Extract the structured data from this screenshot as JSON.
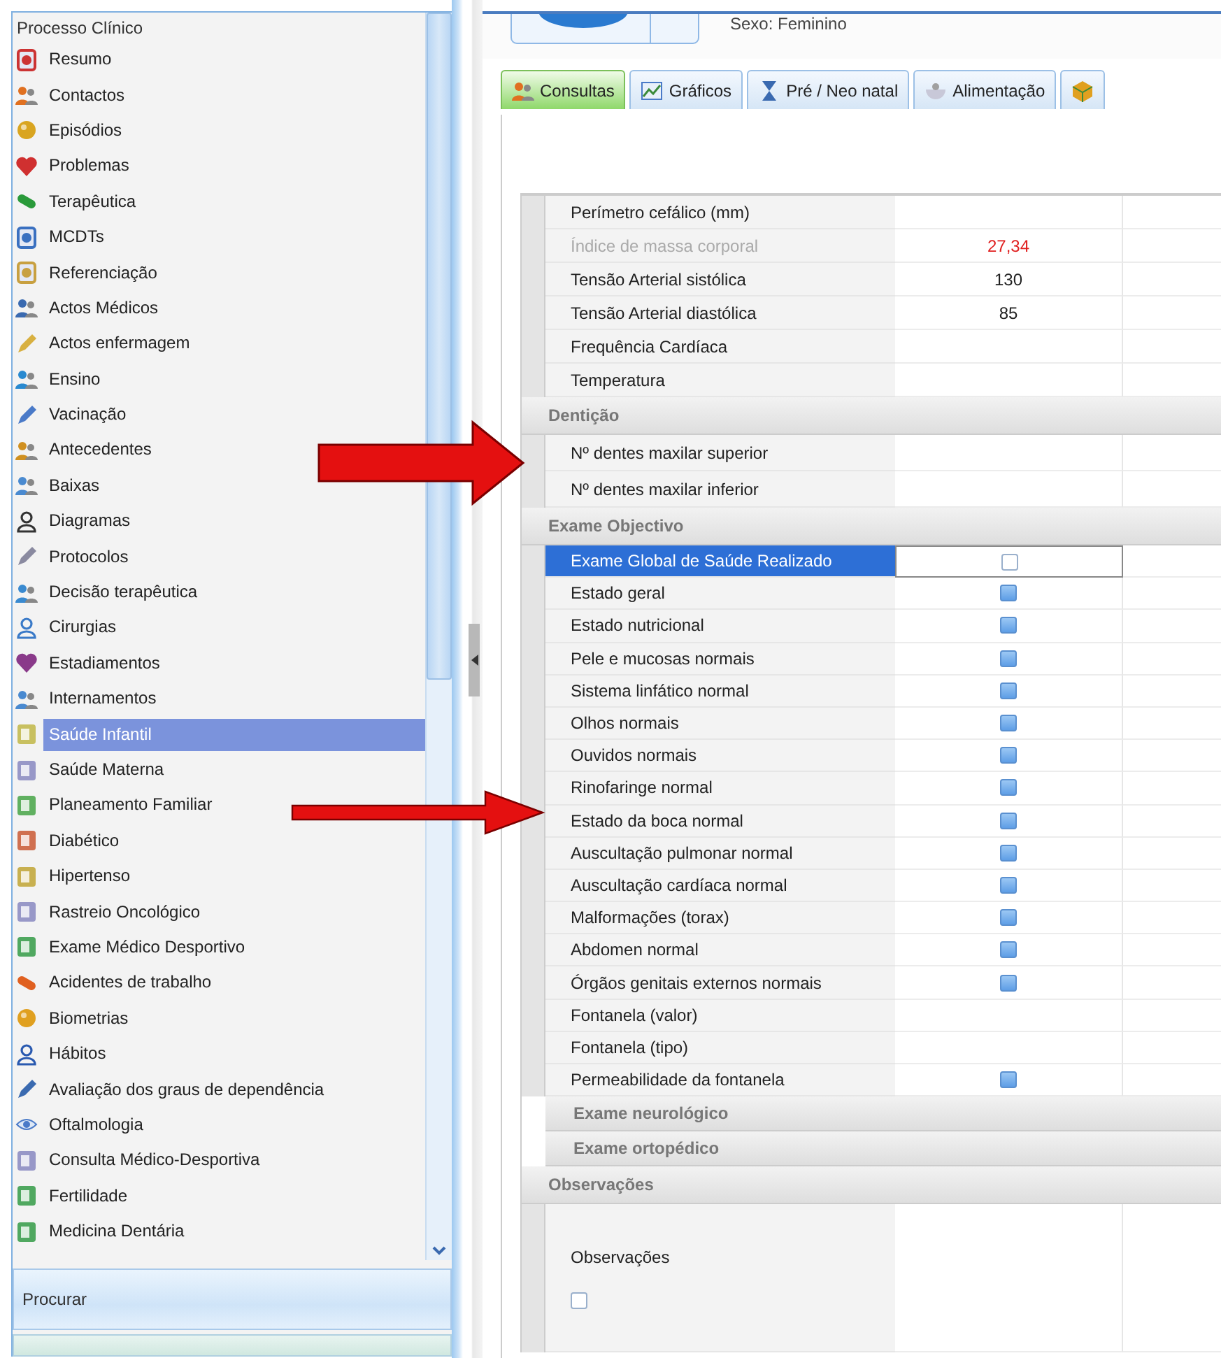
{
  "sidebar": {
    "title": "Processo Clínico",
    "items": [
      {
        "label": "Resumo",
        "kind": "doc",
        "color": "#cc3333",
        "selected": false
      },
      {
        "label": "Contactos",
        "kind": "people",
        "color": "#e07020",
        "selected": false
      },
      {
        "label": "Episódios",
        "kind": "ball",
        "color": "#d9a520",
        "selected": false
      },
      {
        "label": "Problemas",
        "kind": "heart",
        "color": "#d03030",
        "selected": false
      },
      {
        "label": "Terapêutica",
        "kind": "pill",
        "color": "#2a9a3a",
        "selected": false
      },
      {
        "label": "MCDTs",
        "kind": "doc",
        "color": "#3a70c0",
        "selected": false
      },
      {
        "label": "Referenciação",
        "kind": "doc",
        "color": "#c8a040",
        "selected": false
      },
      {
        "label": "Actos Médicos",
        "kind": "people",
        "color": "#3a6ab0",
        "selected": false
      },
      {
        "label": "Actos enfermagem",
        "kind": "pencil",
        "color": "#d8b040",
        "selected": false
      },
      {
        "label": "Ensino",
        "kind": "people",
        "color": "#2a8ad0",
        "selected": false
      },
      {
        "label": "Vacinação",
        "kind": "pencil",
        "color": "#4a7ac8",
        "selected": false
      },
      {
        "label": "Antecedentes",
        "kind": "people",
        "color": "#d09020",
        "selected": false
      },
      {
        "label": "Baixas",
        "kind": "people",
        "color": "#4a8ad0",
        "selected": false
      },
      {
        "label": "Diagramas",
        "kind": "person",
        "color": "#333333",
        "selected": false
      },
      {
        "label": "Protocolos",
        "kind": "pencil",
        "color": "#8a8aa0",
        "selected": false
      },
      {
        "label": "Decisão terapêutica",
        "kind": "people",
        "color": "#3a8ad0",
        "selected": false
      },
      {
        "label": "Cirurgias",
        "kind": "person",
        "color": "#3a7ac8",
        "selected": false
      },
      {
        "label": "Estadiamentos",
        "kind": "heart",
        "color": "#8a3a8a",
        "selected": false
      },
      {
        "label": "Internamentos",
        "kind": "people",
        "color": "#4a8ad0",
        "selected": false
      },
      {
        "label": "Saúde Infantil",
        "kind": "form",
        "color": "#c8c060",
        "selected": true
      },
      {
        "label": "Saúde Materna",
        "kind": "form",
        "color": "#9898c8",
        "selected": false
      },
      {
        "label": "Planeamento Familiar",
        "kind": "form",
        "color": "#60b060",
        "selected": false
      },
      {
        "label": "Diabético",
        "kind": "form",
        "color": "#d07050",
        "selected": false
      },
      {
        "label": "Hipertenso",
        "kind": "form",
        "color": "#c8b050",
        "selected": false
      },
      {
        "label": "Rastreio Oncológico",
        "kind": "form",
        "color": "#9898c8",
        "selected": false
      },
      {
        "label": "Exame Médico Desportivo",
        "kind": "form",
        "color": "#50a860",
        "selected": false
      },
      {
        "label": "Acidentes de trabalho",
        "kind": "pill",
        "color": "#e06020",
        "selected": false
      },
      {
        "label": "Biometrias",
        "kind": "ball",
        "color": "#e0a020",
        "selected": false
      },
      {
        "label": "Hábitos",
        "kind": "person",
        "color": "#2a5ab0",
        "selected": false
      },
      {
        "label": "Avaliação dos graus de dependência",
        "kind": "pencil",
        "color": "#3a6ab0",
        "selected": false
      },
      {
        "label": "Oftalmologia",
        "kind": "eye",
        "color": "#4a7ac8",
        "selected": false
      },
      {
        "label": "Consulta Médico-Desportiva",
        "kind": "form",
        "color": "#9898c8",
        "selected": false
      },
      {
        "label": "Fertilidade",
        "kind": "form",
        "color": "#50a860",
        "selected": false
      },
      {
        "label": "Medicina Dentária",
        "kind": "form",
        "color": "#50a860",
        "selected": false
      }
    ],
    "search_button": "Procurar"
  },
  "header": {
    "patient_sex": "Sexo: Feminino"
  },
  "tabs": [
    {
      "label": "Consultas",
      "kind": "people",
      "selected": true
    },
    {
      "label": "Gráficos",
      "kind": "chart",
      "selected": false
    },
    {
      "label": "Pré / Neo natal",
      "kind": "hourglass",
      "selected": false
    },
    {
      "label": "Alimentação",
      "kind": "bowl",
      "selected": false
    },
    {
      "kind": "cube",
      "selected": false
    }
  ],
  "grid": {
    "sections": [
      {
        "rows": [
          {
            "kind": "text",
            "label": "Perímetro cefálico (mm)",
            "disabled": false,
            "selected": false
          },
          {
            "kind": "text",
            "label": "Índice de massa corporal",
            "value": "27,34",
            "flagged": true,
            "disabled": true,
            "selected": false
          },
          {
            "kind": "text",
            "label": "Tensão Arterial sistólica",
            "value": "130",
            "flagged": false,
            "disabled": false,
            "selected": false
          },
          {
            "kind": "text",
            "label": "Tensão Arterial diastólica",
            "value": "85",
            "flagged": false,
            "disabled": false,
            "selected": false
          },
          {
            "kind": "text",
            "label": "Frequência Cardíaca",
            "disabled": false,
            "selected": false
          },
          {
            "kind": "text",
            "label": "Temperatura",
            "disabled": false,
            "selected": false
          }
        ]
      },
      {
        "title": "Dentição",
        "expanded": true,
        "rows": [
          {
            "kind": "text",
            "label": "Nº dentes maxilar superior",
            "selected": false
          },
          {
            "kind": "text",
            "label": "Nº dentes maxilar inferior",
            "selected": false
          }
        ]
      },
      {
        "title": "Exame Objectivo",
        "expanded": true,
        "rows": [
          {
            "kind": "check",
            "label": "Exame Global de Saúde Realizado",
            "filled": false,
            "selected": true
          },
          {
            "kind": "check",
            "label": "Estado geral",
            "filled": true,
            "selected": false
          },
          {
            "kind": "check",
            "label": "Estado nutricional",
            "filled": true,
            "selected": false
          },
          {
            "kind": "check",
            "label": "Pele e mucosas normais",
            "filled": true,
            "selected": false
          },
          {
            "kind": "check",
            "label": "Sistema linfático normal",
            "filled": true,
            "selected": false
          },
          {
            "kind": "check",
            "label": "Olhos normais",
            "filled": true,
            "selected": false
          },
          {
            "kind": "check",
            "label": "Ouvidos normais",
            "filled": true,
            "selected": false
          },
          {
            "kind": "check",
            "label": "Rinofaringe normal",
            "filled": true,
            "selected": false
          },
          {
            "kind": "check",
            "label": "Estado da boca normal",
            "filled": true,
            "selected": false
          },
          {
            "kind": "check",
            "label": "Auscultação pulmonar normal",
            "filled": true,
            "selected": false
          },
          {
            "kind": "check",
            "label": "Auscultação cardíaca normal",
            "filled": true,
            "selected": false
          },
          {
            "kind": "check",
            "label": "Malformações (torax)",
            "filled": true,
            "selected": false
          },
          {
            "kind": "check",
            "label": "Abdomen normal",
            "filled": true,
            "selected": false
          },
          {
            "kind": "check",
            "label": "Órgãos genitais externos normais",
            "filled": true,
            "selected": false
          },
          {
            "kind": "text",
            "label": "Fontanela (valor)",
            "selected": false
          },
          {
            "kind": "text",
            "label": "Fontanela (tipo)",
            "selected": false
          },
          {
            "kind": "check",
            "label": "Permeabilidade da fontanela",
            "filled": true,
            "selected": false
          }
        ],
        "subsections": [
          {
            "title": "Exame neurológico",
            "expanded": false
          },
          {
            "title": "Exame ortopédico",
            "expanded": false
          }
        ]
      },
      {
        "title": "Observações",
        "expanded": true,
        "rows": [
          {
            "kind": "memo",
            "label": "Observações",
            "filled": false,
            "selected": false
          }
        ]
      }
    ]
  }
}
